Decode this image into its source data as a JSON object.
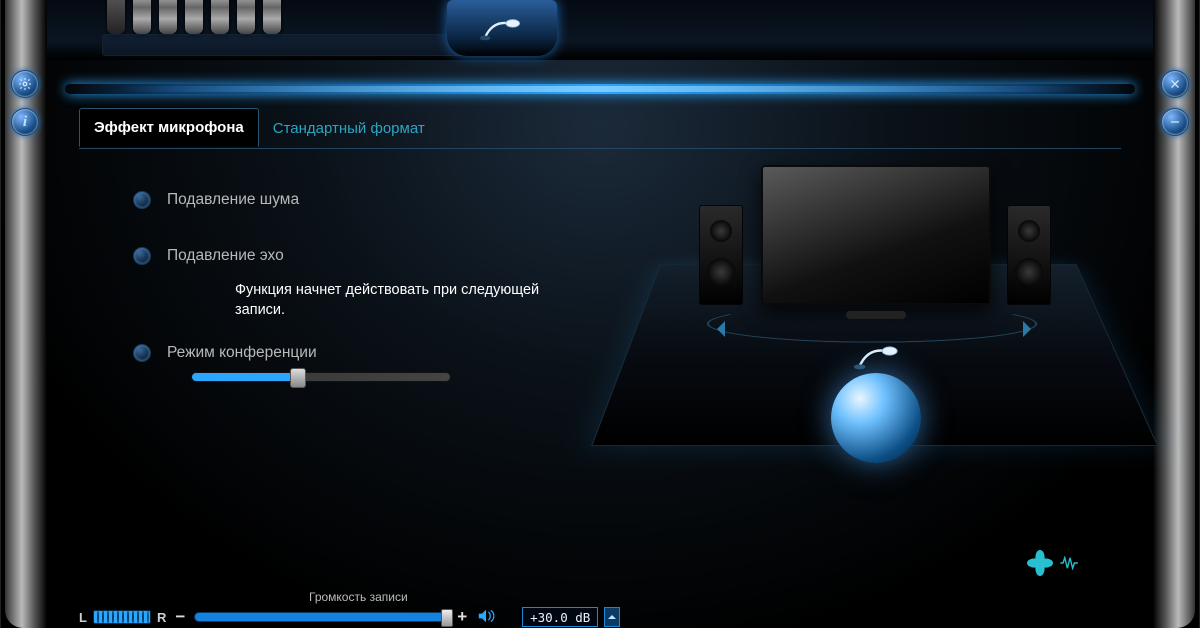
{
  "tabs": {
    "effects": "Эффект микрофона",
    "format": "Стандартный формат"
  },
  "options": {
    "noise": "Подавление шума",
    "echo": "Подавление эхо",
    "conf": "Режим конференции",
    "hint": "Функция начнет действовать при следующей записи."
  },
  "slider": {
    "conf_value_pct": 40
  },
  "volume": {
    "label": "Громкость записи",
    "left": "L",
    "right": "R",
    "minus": "−",
    "plus": "+",
    "readout": "+30.0 dB"
  },
  "colors": {
    "accent": "#2aa6ff",
    "teal": "#2dd4e8"
  }
}
